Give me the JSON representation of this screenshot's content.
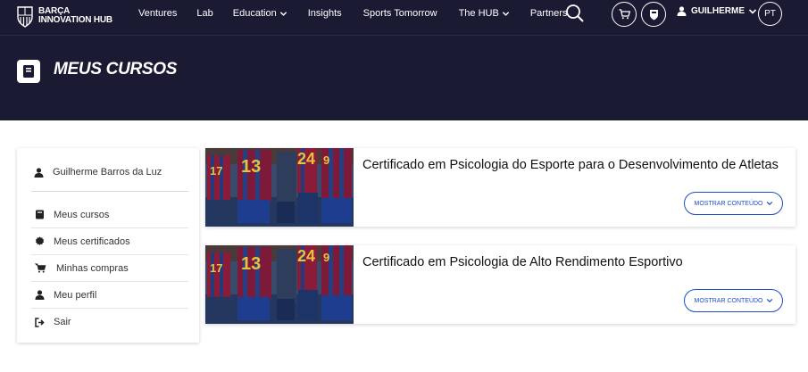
{
  "nav": {
    "logo_line1": "BARÇA",
    "logo_line2": "INNOVATION HUB",
    "items": [
      {
        "label": "Ventures",
        "has_dropdown": false
      },
      {
        "label": "Lab",
        "has_dropdown": false
      },
      {
        "label": "Education",
        "has_dropdown": true
      },
      {
        "label": "Insights",
        "has_dropdown": false
      },
      {
        "label": "Sports Tomorrow",
        "has_dropdown": false
      },
      {
        "label": "The HUB",
        "has_dropdown": true
      },
      {
        "label": "Partners",
        "has_dropdown": false
      }
    ],
    "user_name": "GUILHERME",
    "language": "PT"
  },
  "header": {
    "title": "MEUS CURSOS",
    "icon": "book-icon"
  },
  "sidebar": {
    "user_full_name": "Guilherme Barros da Luz",
    "items": [
      {
        "label": "Meus cursos",
        "icon": "book-icon"
      },
      {
        "label": "Meus certificados",
        "icon": "certificate-icon"
      },
      {
        "label": "Minhas compras",
        "icon": "cart-icon"
      },
      {
        "label": "Meu perfil",
        "icon": "user-icon"
      },
      {
        "label": "Sair",
        "icon": "logout-icon"
      }
    ]
  },
  "courses": [
    {
      "title": "Certificado em Psicologia do Esporte para o Desenvolvimento de Atletas",
      "button_label": "MOSTRAR CONTEÚDO"
    },
    {
      "title": "Certificado em Psicologia de Alto Rendimento Esportivo",
      "button_label": "MOSTRAR CONTEÚDO"
    }
  ],
  "colors": {
    "navy": "#1b1a33",
    "accent_blue": "#1c4ec9"
  }
}
